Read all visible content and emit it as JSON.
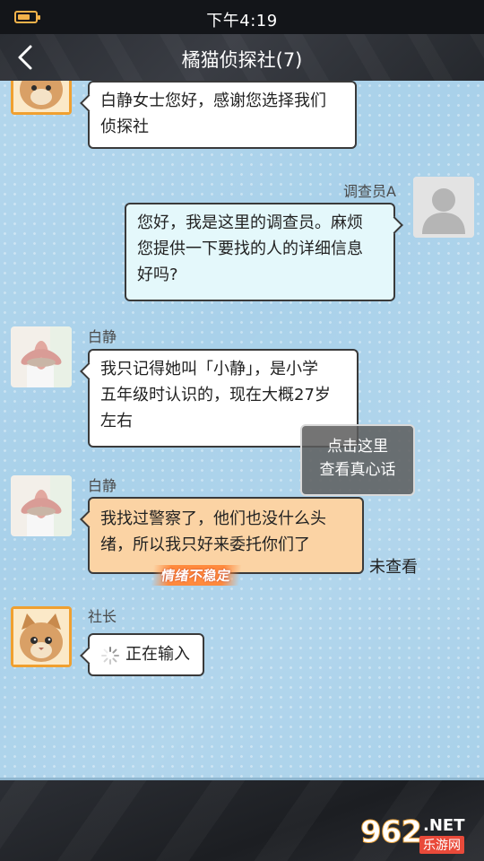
{
  "status_bar": {
    "time": "下午4:19",
    "battery_level": 0.7,
    "battery_color": "#f3b24a"
  },
  "header": {
    "title": "橘猫侦探社(7)",
    "back_icon": "chevron-left-icon"
  },
  "messages": [
    {
      "sender": "",
      "avatar": "orange-cat-avatar",
      "side": "left",
      "bubble_color": "#ffffff",
      "text_lines": [
        "白静女士您好，感谢您选择我们",
        "侦探社"
      ]
    },
    {
      "sender": "调查员A",
      "avatar": "default-user-avatar",
      "side": "right",
      "bubble_color": "#e4f8fb",
      "text_lines": [
        "您好，我是这里的调查员。麻烦",
        "您提供一下要找的人的详细信息",
        "好吗?"
      ]
    },
    {
      "sender": "白静",
      "avatar": "succulent-plant-avatar",
      "side": "left",
      "bubble_color": "#ffffff",
      "text_lines": [
        "我只记得她叫「小静」，是小学",
        "五年级时认识的，现在大概27岁",
        "左右"
      ]
    },
    {
      "sender": "白静",
      "avatar": "succulent-plant-avatar",
      "side": "left",
      "bubble_color": "#fbd3a4",
      "text_lines": [
        "我找过警察了，他们也没什么头",
        "绪，所以我只好来委托你们了"
      ],
      "emotion_tag": "情绪不稳定",
      "read_status": "未查看"
    },
    {
      "sender": "社长",
      "avatar": "orange-cat-avatar",
      "side": "left",
      "bubble_color": "#ffffff",
      "typing_text": "正在输入"
    }
  ],
  "hint_popup": {
    "lines": [
      "点击这里",
      "查看真心话"
    ]
  },
  "watermark": {
    "number": "962",
    "suffix": ".NET",
    "site": "乐游网"
  },
  "colors": {
    "chat_bg": "#a9d1ea",
    "header_bg": "#2f3238",
    "emotion": "#ff8a3d"
  }
}
